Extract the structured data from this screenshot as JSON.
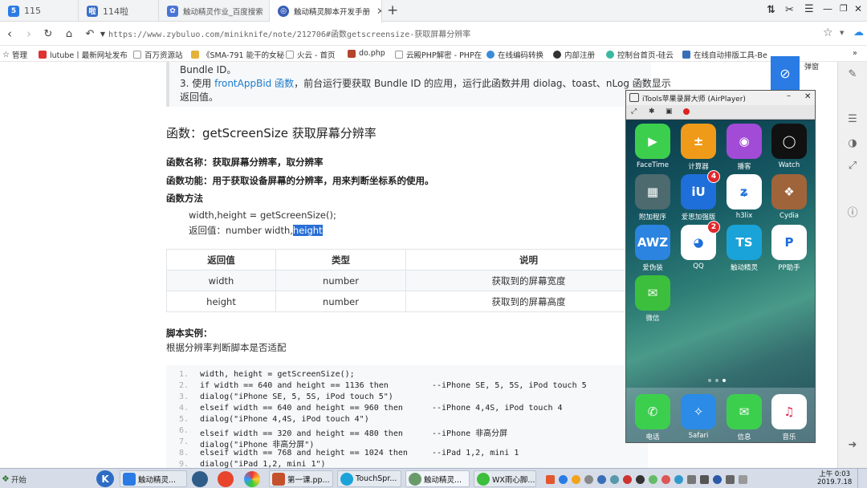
{
  "tabs": [
    {
      "label": "115",
      "active": false
    },
    {
      "label": "114啦",
      "active": false
    },
    {
      "label": "触动精灵作业_百度搜索",
      "active": false
    },
    {
      "label": "触动精灵脚本开发手册",
      "active": true
    }
  ],
  "new_tab": "+",
  "address": {
    "url": "https://www.zybuluo.com/miniknife/note/212706#函数getscreensize-获取屏幕分辨率"
  },
  "bookmarks": [
    "管理",
    "lutube丨最新网址发布",
    "百万资源站",
    "《SMA-791 能干的女秘",
    "火云 - 首页",
    "do.php",
    "云殿PHP解密 - PHP在",
    "在线编码转换",
    "内部注册",
    "控制台首页-硅云",
    "在线自动排版工具-Be"
  ],
  "doc": {
    "line_top": "Bundle ID。",
    "item3_pre": "3. 使用 ",
    "item3_link1": "frontAppBid",
    "item3_link2": "函数",
    "item3_post": "，前台运行要获取 Bundle ID 的应用，运行此函数并用 diolag、toast、nLog 函数显示",
    "item3_cont": "返回值。",
    "heading": "函数：getScreenSize 获取屏幕分辨率",
    "fn_name": "函数名称：获取屏幕分辨率，取分辨率",
    "fn_desc": "函数功能：用于获取设备屏幕的分辨率，用来判断坐标系的使用。",
    "fn_method": "函数方法",
    "usage": "width,height = getScreenSize();",
    "ret_prefix": "返回值：number width,",
    "ret_hl": "height",
    "table": {
      "headers": [
        "返回值",
        "类型",
        "说明"
      ],
      "rows": [
        [
          "width",
          "number",
          "获取到的屏幕宽度"
        ],
        [
          "height",
          "number",
          "获取到的屏幕高度"
        ]
      ]
    },
    "example_title": "脚本实例：",
    "example_desc": "根据分辨率判断脚本是否适配",
    "code": [
      {
        "n": "1.",
        "text": "width, height = getScreenSize();"
      },
      {
        "n": "2.",
        "text": "if width == 640 and height == 1136 then         --iPhone SE, 5, 5S, iPod touch 5"
      },
      {
        "n": "3.",
        "text": "dialog(\"iPhone SE, 5, 5S, iPod touch 5\")"
      },
      {
        "n": "4.",
        "text": "elseif width == 640 and height == 960 then      --iPhone 4,4S, iPod touch 4"
      },
      {
        "n": "5.",
        "text": "dialog(\"iPhone 4,4S, iPod touch 4\")"
      },
      {
        "n": "6.",
        "text": "elseif width == 320 and height == 480 then      --iPhone 非高分屏"
      },
      {
        "n": "7.",
        "text": "dialog(\"iPhone 非高分屏\")"
      },
      {
        "n": "8.",
        "text": "elseif width == 768 and height == 1024 then     --iPad 1,2, mini 1"
      },
      {
        "n": "9.",
        "text": "dialog(\"iPad 1,2, mini 1\")"
      }
    ]
  },
  "phone": {
    "title": "iTools苹果录屏大师 (AirPlayer)",
    "apps": [
      {
        "label": "FaceTime",
        "color": "#3ccf4e",
        "glyph": "▶"
      },
      {
        "label": "计算器",
        "color": "#f09a1a",
        "glyph": "±"
      },
      {
        "label": "播客",
        "color": "#a24bd6",
        "glyph": "◉"
      },
      {
        "label": "Watch",
        "color": "#111111",
        "glyph": "◯"
      },
      {
        "label": "附加程序",
        "color": "#4d6a6e",
        "glyph": "▦"
      },
      {
        "label": "爱思加强版",
        "color": "#1e6fd9",
        "glyph": "iU",
        "badge": "4"
      },
      {
        "label": "h3lix",
        "color": "#ffffff",
        "glyph": "ʑ"
      },
      {
        "label": "Cydia",
        "color": "#a0643a",
        "glyph": "❖"
      },
      {
        "label": "爱伪装",
        "color": "#2b84e0",
        "glyph": "AWZ"
      },
      {
        "label": "QQ",
        "color": "#ffffff",
        "glyph": "◕",
        "badge": "2"
      },
      {
        "label": "触动精灵",
        "color": "#1aa3d8",
        "glyph": "TS"
      },
      {
        "label": "PP助手",
        "color": "#ffffff",
        "glyph": "P"
      },
      {
        "label": "微信",
        "color": "#3cbf3c",
        "glyph": "✉"
      }
    ],
    "dock": [
      {
        "label": "电话",
        "color": "#3ccf4e",
        "glyph": "✆"
      },
      {
        "label": "Safari",
        "color": "#2b8be6",
        "glyph": "✧"
      },
      {
        "label": "信息",
        "color": "#3ccf4e",
        "glyph": "✉"
      },
      {
        "label": "音乐",
        "color": "#ffffff",
        "glyph": "♫"
      }
    ]
  },
  "taskbar": {
    "start": "开始",
    "items": [
      "触动精灵...",
      "第一课.pp...",
      "TouchSpr...",
      "触动精灵...",
      "WX雨心脚..."
    ],
    "clock_time": "上午 0:03",
    "clock_date": "2019.7.18"
  },
  "popup_side": "弹窗"
}
